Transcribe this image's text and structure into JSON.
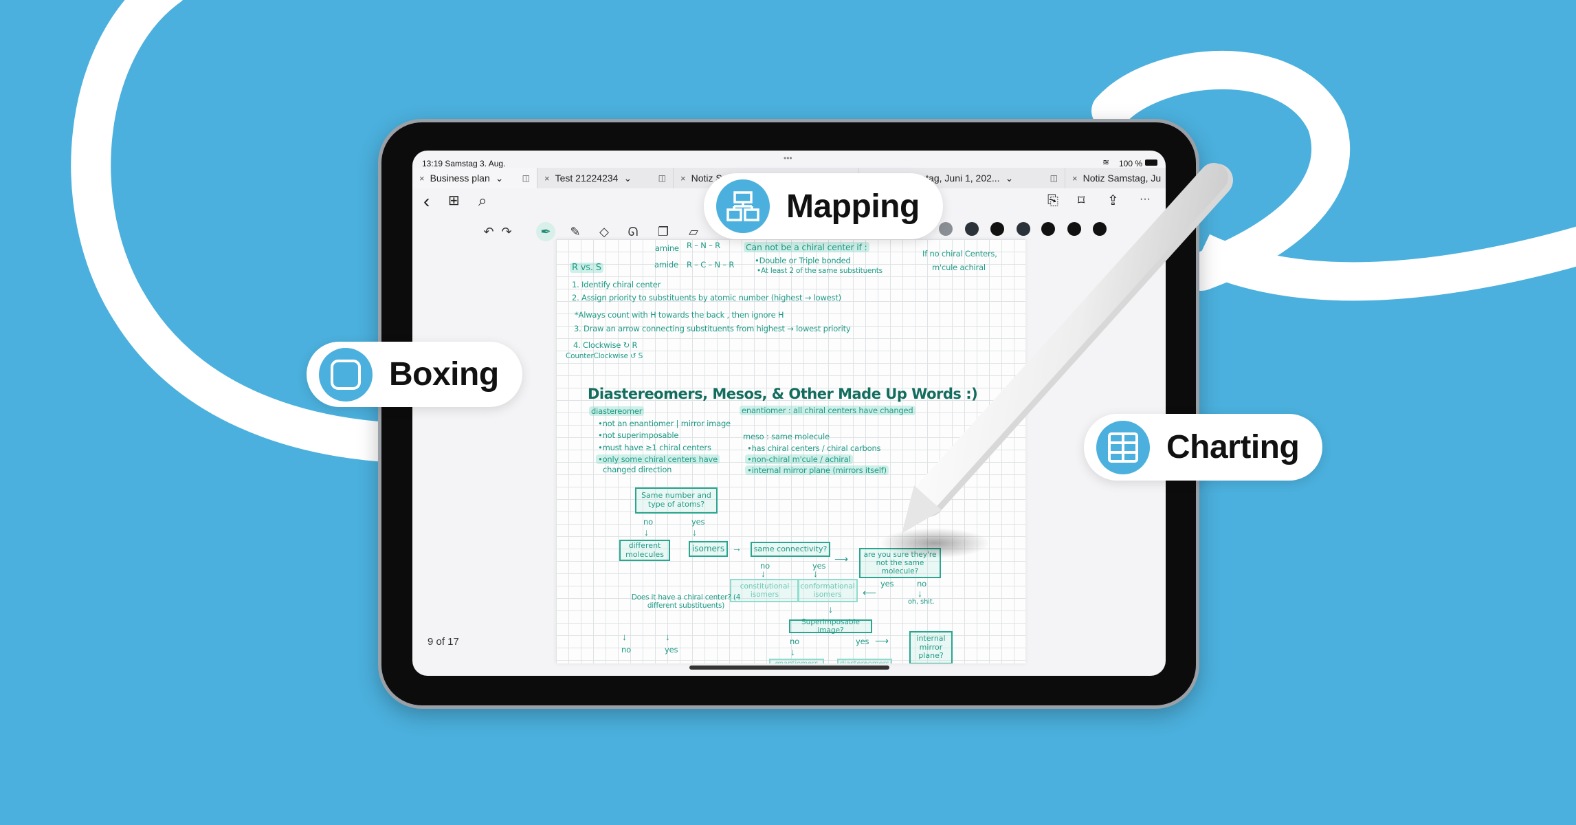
{
  "colors": {
    "background": "#4BB0DD",
    "ink": "#1f9a86",
    "ink_dark": "#136d5e",
    "swatches": [
      "#8a8f95",
      "#2b323a",
      "#111111",
      "#2b323a",
      "#111111",
      "#111111",
      "#111111"
    ]
  },
  "status_bar": {
    "time_date": "13:19  Samstag 3. Aug.",
    "battery": "100 %",
    "dots": "•••"
  },
  "tabs": [
    {
      "label": "Business plan",
      "active": true
    },
    {
      "label": "Test 21224234",
      "active": false
    },
    {
      "label": "Notiz Samstag, Juni 1, 202...",
      "active": false
    },
    {
      "label": "Notiz Samstag, Juni 1, 202...",
      "active": false
    },
    {
      "label": "Notiz Samstag, Ju",
      "active": false
    }
  ],
  "tab_close": "×",
  "tab_chevron": "⌄",
  "tab_split": "◫",
  "toolbar": {
    "back": "‹",
    "grid": "⊞",
    "search": "⌕",
    "doc": "⎘",
    "bookmark": "⌑",
    "share": "⇪",
    "more": "···",
    "undo": "↶",
    "redo": "↷",
    "pen": "✒",
    "highlighter": "✎",
    "eraser": "◇",
    "lasso": "ᘏ",
    "shapes": "❐",
    "ruler": "▱",
    "active_tool": "pen"
  },
  "page_indicator": "9 of  17",
  "note": {
    "amine": "amine",
    "amine_formula": "R – N – R",
    "amide": "amide",
    "amide_formula": "R – C – N – R",
    "cannot_head": "Can not be a chiral center if :",
    "cannot_1": "•Double or Triple bonded",
    "cannot_2": "•At least 2 of the same substituents",
    "no_chiral_1": "If no chiral Centers,",
    "no_chiral_2": "m'cule achiral",
    "rvs": "R vs. S",
    "step1": "1. Identify chiral center",
    "step2": "2. Assign priority to substituents by atomic number (highest → lowest)",
    "always": "*Always count with H towards the back ,  then  ignore  H",
    "step3": "3. Draw an arrow connecting substituents from highest → lowest priority",
    "step4": "4. Clockwise ↻ R",
    "ccw": "CounterClockwise ↺ S",
    "title": "Diastereomers, Mesos, & Other Made Up Words :)",
    "diastereomer": "diastereomer",
    "dia_bullets": [
      "•not an enantiomer | mirror image",
      "•not superimposable",
      "•must have  ≥1 chiral centers",
      "•only some chiral centers have",
      "  changed direction"
    ],
    "enantiomer": "enantiomer : all chiral centers have changed",
    "meso": "meso : same molecule",
    "meso_bullets": [
      "•has chiral centers / chiral carbons",
      "•non-chiral m'cule / achiral",
      "•internal mirror plane (mirrors itself)"
    ],
    "flow": {
      "q1": "Same number and type of atoms?",
      "no": "no",
      "yes": "yes",
      "different": "different molecules",
      "isomers": "isomers",
      "same_conn": "same connectivity?",
      "sure": "are you sure they're not the same molecule?",
      "constitutional": "constitutional isomers",
      "conformational": "conformational isomers",
      "oh": "oh, shit.",
      "chiral_q": "Does it have a chiral center? (4 different substituents)",
      "superimposable": "Superimposable image?",
      "internal": "internal mirror plane?",
      "enantiomers": "enantiomers",
      "diastereomers": "diastereomers"
    }
  },
  "features": {
    "mapping": "Mapping",
    "boxing": "Boxing",
    "charting": "Charting"
  }
}
